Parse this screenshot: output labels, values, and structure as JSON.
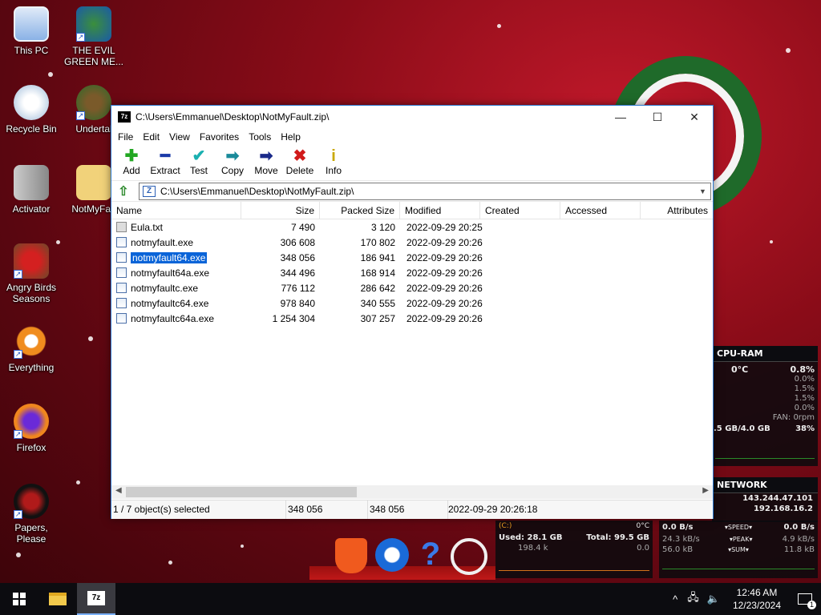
{
  "desktop_icons": [
    {
      "label": "This PC"
    },
    {
      "label": "THE EVIL GREEN ME..."
    },
    {
      "label": "Recycle Bin"
    },
    {
      "label": "Undertal"
    },
    {
      "label": "Activator"
    },
    {
      "label": "NotMyFau"
    },
    {
      "label": "Angry Birds Seasons"
    },
    {
      "label": "Everything"
    },
    {
      "label": "Firefox"
    },
    {
      "label": "Papers, Please"
    }
  ],
  "window": {
    "title": "C:\\Users\\Emmanuel\\Desktop\\NotMyFault.zip\\",
    "app_icon_text": "7z",
    "controls": {
      "minimize": "—",
      "maximize": "☐",
      "close": "✕"
    }
  },
  "menu": [
    "File",
    "Edit",
    "View",
    "Favorites",
    "Tools",
    "Help"
  ],
  "toolbar": [
    {
      "label": "Add",
      "icon": "add-icon",
      "glyph": "✚",
      "color": "#22a722"
    },
    {
      "label": "Extract",
      "icon": "extract-icon",
      "glyph": "━",
      "color": "#1a3aa8"
    },
    {
      "label": "Test",
      "icon": "test-icon",
      "glyph": "✔",
      "color": "#1ab0b0"
    },
    {
      "label": "Copy",
      "icon": "copy-icon",
      "glyph": "➡",
      "color": "#1a8a9a"
    },
    {
      "label": "Move",
      "icon": "move-icon",
      "glyph": "➡",
      "color": "#1a2a8a"
    },
    {
      "label": "Delete",
      "icon": "delete-icon",
      "glyph": "✖",
      "color": "#d11a1a"
    },
    {
      "label": "Info",
      "icon": "info-icon",
      "glyph": "i",
      "color": "#c9a800"
    }
  ],
  "address": {
    "path": "C:\\Users\\Emmanuel\\Desktop\\NotMyFault.zip\\"
  },
  "columns": [
    "Name",
    "Size",
    "Packed Size",
    "Modified",
    "Created",
    "Accessed",
    "Attributes"
  ],
  "files": [
    {
      "name": "Eula.txt",
      "size": "7 490",
      "packed": "3 120",
      "modified": "2022-09-29 20:25",
      "type": "txt",
      "selected": false
    },
    {
      "name": "notmyfault.exe",
      "size": "306 608",
      "packed": "170 802",
      "modified": "2022-09-29 20:26",
      "type": "exe",
      "selected": false
    },
    {
      "name": "notmyfault64.exe",
      "size": "348 056",
      "packed": "186 941",
      "modified": "2022-09-29 20:26",
      "type": "exe",
      "selected": true
    },
    {
      "name": "notmyfault64a.exe",
      "size": "344 496",
      "packed": "168 914",
      "modified": "2022-09-29 20:26",
      "type": "exe",
      "selected": false
    },
    {
      "name": "notmyfaultc.exe",
      "size": "776 112",
      "packed": "286 642",
      "modified": "2022-09-29 20:26",
      "type": "exe",
      "selected": false
    },
    {
      "name": "notmyfaultc64.exe",
      "size": "978 840",
      "packed": "340 555",
      "modified": "2022-09-29 20:26",
      "type": "exe",
      "selected": false
    },
    {
      "name": "notmyfaultc64a.exe",
      "size": "1 254 304",
      "packed": "307 257",
      "modified": "2022-09-29 20:26",
      "type": "exe",
      "selected": false
    }
  ],
  "status": {
    "selection": "1 / 7 object(s) selected",
    "size": "348 056",
    "packed": "348 056",
    "modified": "2022-09-29 20:26:18"
  },
  "cpu_ram": {
    "title": "CPU-RAM",
    "temp": "0°C",
    "cpu_total": "0.8%",
    "cores": [
      "0.0%",
      "1.5%",
      "1.5%",
      "0.0%"
    ],
    "fan": "FAN: 0rpm",
    "ram": ".5 GB/4.0 GB",
    "ram_pct": "38%"
  },
  "network": {
    "title": "NETWORK",
    "ip_public": "143.244.47.101",
    "ip_local": "192.168.16.2",
    "speed_label": "▾SPEED▾",
    "peak_label": "▾PEAK▾",
    "sum_label": "▾SUM▾",
    "down_speed": "0.0 B/s",
    "up_speed": "0.0 B/s",
    "down_peak": "24.3 kB/s",
    "up_peak": "4.9 kB/s",
    "down_sum": "56.0 kB",
    "up_sum": "11.8 kB"
  },
  "disk": {
    "drive": "(C:)",
    "temp": "0°C",
    "used": "Used: 28.1 GB",
    "total": "Total: 99.5 GB",
    "read": "198.4 k",
    "write": "0.0"
  },
  "dock": {
    "help_glyph": "?"
  },
  "taskbar": {
    "time": "12:46 AM",
    "date": "12/23/2024",
    "chevron": "^",
    "notif_count": "1"
  }
}
